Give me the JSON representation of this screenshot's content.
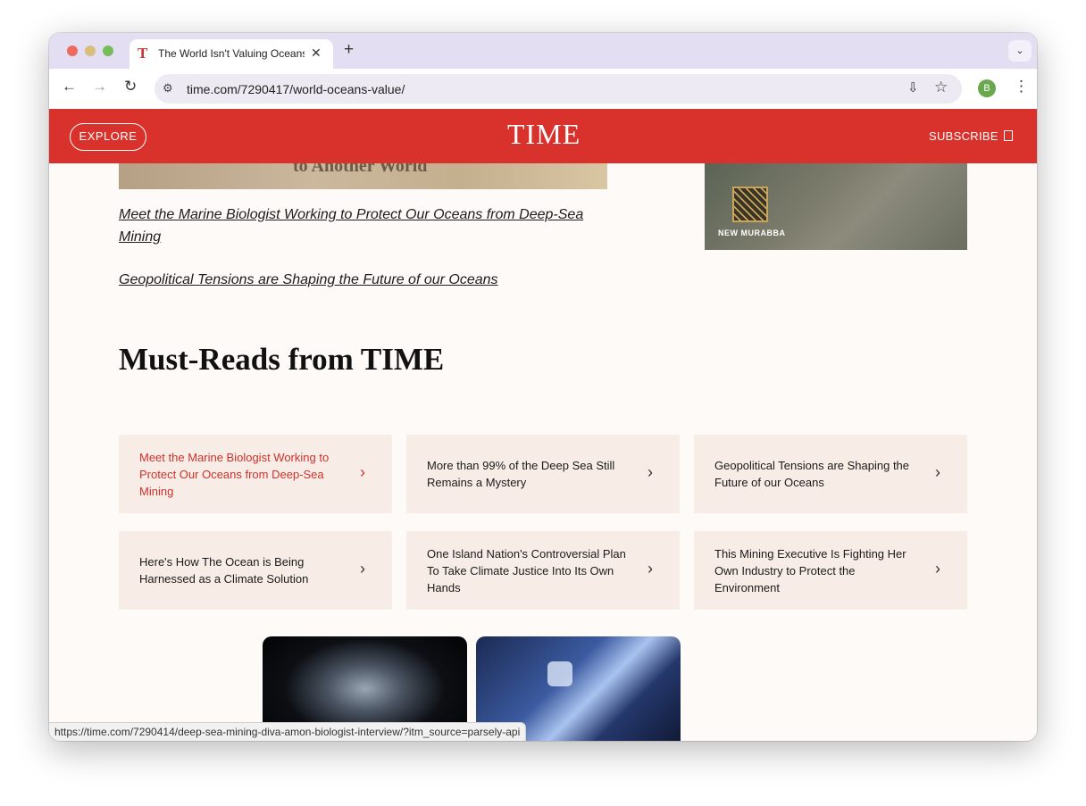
{
  "browser": {
    "tab": {
      "favicon": "T",
      "title": "The World Isn't Valuing Oceans",
      "close": "✕"
    },
    "new_tab": "+",
    "tab_dropdown": "⌄",
    "nav": {
      "back": "←",
      "forward": "→",
      "reload": "↻"
    },
    "site_info_icon": "⚙",
    "url": "time.com/7290417/world-oceans-value/",
    "install_icon": "⇩",
    "star_icon": "☆",
    "profile_initial": "B",
    "menu_icon": "⋮",
    "status_url": "https://time.com/7290414/deep-sea-mining-diva-amon-biologist-interview/?itm_source=parsely-api"
  },
  "header": {
    "explore_label": "EXPLORE",
    "logo": "TIME",
    "subscribe_label": "SUBSCRIBE",
    "brand_color": "#d9312b"
  },
  "top_images": {
    "left_caption": "to Another World",
    "right_label": "NEW MURABBA"
  },
  "related_links": [
    "Meet the Marine Biologist Working to Protect Our Oceans from Deep-Sea Mining",
    "Geopolitical Tensions are Shaping the Future of our Oceans"
  ],
  "must_reads": {
    "title": "Must-Reads from TIME",
    "chevron": "›",
    "items": [
      {
        "text": "Meet the Marine Biologist Working to Protect Our Oceans from Deep-Sea Mining",
        "active": true
      },
      {
        "text": "More than 99% of the Deep Sea Still Remains a Mystery",
        "active": false
      },
      {
        "text": "Geopolitical Tensions are Shaping the Future of our Oceans",
        "active": false
      },
      {
        "text": "Here's How The Ocean is Being Harnessed as a Climate Solution",
        "active": false
      },
      {
        "text": "One Island Nation's Controversial Plan To Take Climate Justice Into Its Own Hands",
        "active": false
      },
      {
        "text": "This Mining Executive Is Fighting Her Own Industry to Protect the Environment",
        "active": false
      }
    ]
  }
}
